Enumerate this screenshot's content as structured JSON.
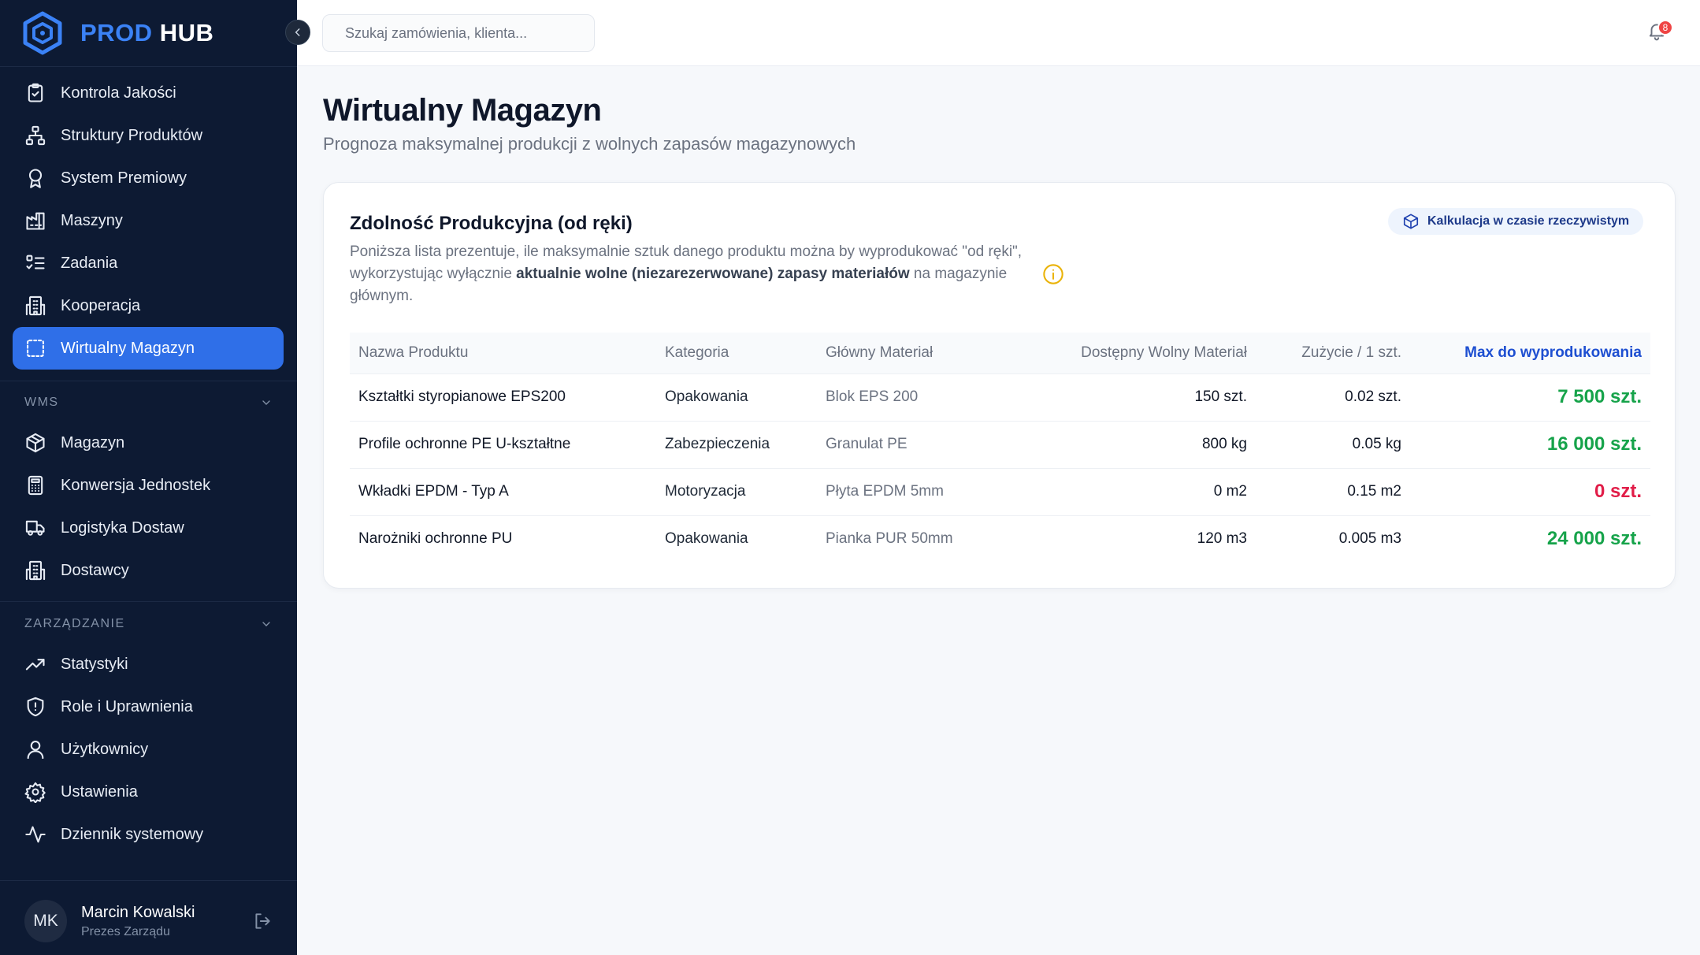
{
  "brand": {
    "part1": "PROD",
    "part2": "HUB"
  },
  "sidebar": {
    "main_items": [
      {
        "label": "Kontrola Jakości",
        "icon": "clipboard-check-icon"
      },
      {
        "label": "Struktury Produktów",
        "icon": "hierarchy-icon"
      },
      {
        "label": "System Premiowy",
        "icon": "award-icon"
      },
      {
        "label": "Maszyny",
        "icon": "factory-icon"
      },
      {
        "label": "Zadania",
        "icon": "task-list-icon"
      },
      {
        "label": "Kooperacja",
        "icon": "building-icon"
      },
      {
        "label": "Wirtualny Magazyn",
        "icon": "dashed-square-icon",
        "active": true
      }
    ],
    "sections": [
      {
        "label": "WMS",
        "items": [
          {
            "label": "Magazyn",
            "icon": "package-icon"
          },
          {
            "label": "Konwersja Jednostek",
            "icon": "calculator-icon"
          },
          {
            "label": "Logistyka Dostaw",
            "icon": "truck-icon"
          },
          {
            "label": "Dostawcy",
            "icon": "building-icon"
          }
        ]
      },
      {
        "label": "ZARZĄDZANIE",
        "items": [
          {
            "label": "Statystyki",
            "icon": "trend-up-icon"
          },
          {
            "label": "Role i Uprawnienia",
            "icon": "shield-alert-icon"
          },
          {
            "label": "Użytkownicy",
            "icon": "user-icon"
          },
          {
            "label": "Ustawienia",
            "icon": "gear-icon"
          },
          {
            "label": "Dziennik systemowy",
            "icon": "activity-icon"
          }
        ]
      }
    ],
    "user": {
      "initials": "MK",
      "name": "Marcin Kowalski",
      "role": "Prezes Zarządu"
    }
  },
  "header": {
    "search_placeholder": "Szukaj zamówienia, klienta...",
    "notifications_count": "8"
  },
  "page": {
    "title": "Wirtualny Magazyn",
    "subtitle": "Prognoza maksymalnej produkcji z wolnych zapasów magazynowych"
  },
  "card": {
    "title": "Zdolność Produkcyjna (od ręki)",
    "desc_part1": "Poniższa lista prezentuje, ile maksymalnie sztuk danego produktu można by wyprodukować \"od ręki\", wykorzystując wyłącznie ",
    "desc_bold": "aktualnie wolne (niezarezerwowane) zapasy materiałów",
    "desc_part2": " na magazynie głównym.",
    "live_label": "Kalkulacja w czasie rzeczywistym"
  },
  "table": {
    "headers": {
      "name": "Nazwa Produktu",
      "category": "Kategoria",
      "material": "Główny Materiał",
      "available": "Dostępny Wolny Materiał",
      "usage": "Zużycie / 1 szt.",
      "max": "Max do wyprodukowania"
    },
    "rows": [
      {
        "name": "Kształtki styropianowe EPS200",
        "category": "Opakowania",
        "material": "Blok EPS 200",
        "available": "150 szt.",
        "usage": "0.02 szt.",
        "max": "7 500 szt.",
        "status": "ok"
      },
      {
        "name": "Profile ochronne PE U-kształtne",
        "category": "Zabezpieczenia",
        "material": "Granulat PE",
        "available": "800 kg",
        "usage": "0.05 kg",
        "max": "16 000 szt.",
        "status": "ok"
      },
      {
        "name": "Wkładki EPDM - Typ A",
        "category": "Motoryzacja",
        "material": "Płyta EPDM 5mm",
        "available": "0 m2",
        "usage": "0.15 m2",
        "max": "0 szt.",
        "status": "zero"
      },
      {
        "name": "Narożniki ochronne PU",
        "category": "Opakowania",
        "material": "Pianka PUR 50mm",
        "available": "120 m3",
        "usage": "0.005 m3",
        "max": "24 000 szt.",
        "status": "ok"
      }
    ]
  },
  "colors": {
    "sidebar_bg": "#0d1a33",
    "accent": "#2f6fe8",
    "ok": "#16a34a",
    "zero": "#e11d48"
  }
}
